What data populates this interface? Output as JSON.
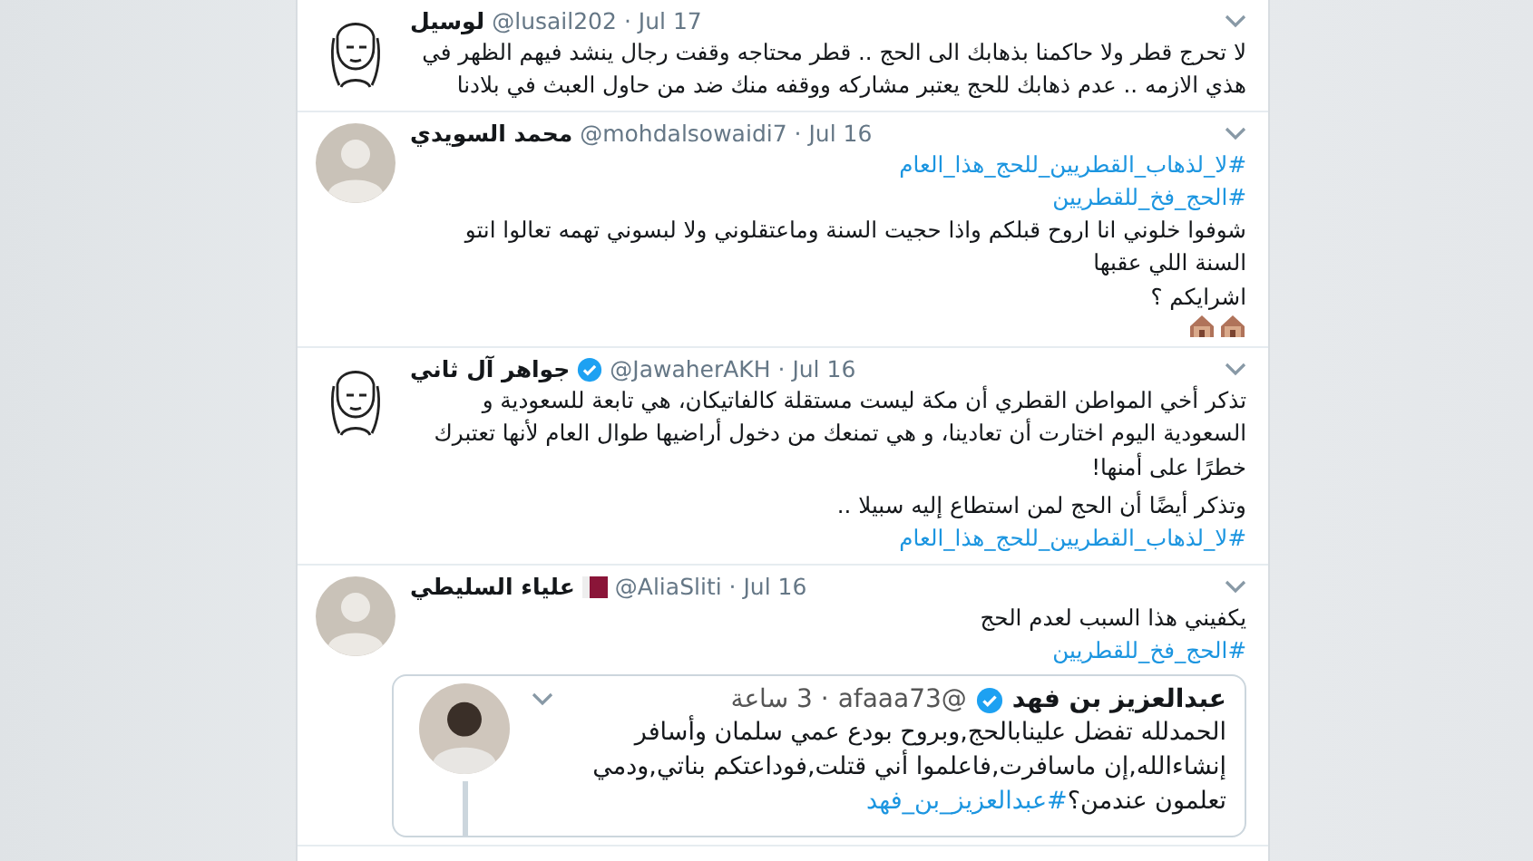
{
  "tweets": [
    {
      "name": "لوسيل",
      "meta": "@lusail202 · Jul 17",
      "avatar": {
        "kind": "sketch"
      },
      "blocks": [
        {
          "kind": "text",
          "text": "لا تحرج قطر ولا حاكمنا بذهابك الى الحج .. قطر محتاجه وقفت رجال ينشد فيهم الظهر في هذي الازمه .. عدم ذهابك للحج يعتبر مشاركه ووقفه منك ضد من حاول العبث في بلادنا"
        }
      ]
    },
    {
      "name": "محمد السويدي",
      "meta": "@mohdalsowaidi7 · Jul 16",
      "avatar": {
        "kind": "photo"
      },
      "blocks": [
        {
          "kind": "hashtag",
          "text": "#لا_لذهاب_القطريين_للحج_هذا_العام"
        },
        {
          "kind": "hashtag",
          "text": "#الحج_فخ_للقطريين"
        },
        {
          "kind": "text",
          "text": "شوفوا خلوني انا اروح قبلكم واذا حجيت السنة وماعتقلوني ولا لبسوني تهمه تعالوا انتو السنة اللي عقبها"
        },
        {
          "kind": "text",
          "text": "اشرايكم ؟"
        },
        {
          "kind": "icons",
          "icons": [
            {
              "kind": "house"
            },
            {
              "kind": "house"
            }
          ]
        }
      ]
    },
    {
      "name": "جواهر آل ثاني",
      "meta": "@JawaherAKH · Jul 16",
      "verified": true,
      "avatar": {
        "kind": "sketch"
      },
      "blocks": [
        {
          "kind": "text",
          "text": "تذكر أخي المواطن القطري أن مكة ليست مستقلة كالفاتيكان، هي تابعة للسعودية و السعودية اليوم اختارت أن تعادينا، و هي تمنعك من دخول أراضيها طوال العام لأنها تعتبرك خطرًا على أمنها!"
        },
        {
          "kind": "gap"
        },
        {
          "kind": "text",
          "text": "وتذكر أيضًا أن الحج لمن استطاع إليه سبيلا .."
        },
        {
          "kind": "hashtag",
          "text": "#لا_لذهاب_القطريين_للحج_هذا_العام"
        }
      ]
    },
    {
      "name": "علياء السليطي",
      "meta": "@AliaSliti · Jul 16",
      "flag": true,
      "avatar": {
        "kind": "photo"
      },
      "blocks": [
        {
          "kind": "text",
          "text": "يكفيني هذا السبب لعدم الحج"
        },
        {
          "kind": "hashtag",
          "text": "#الحج_فخ_للقطريين"
        }
      ],
      "embed": {
        "name": "عبدالعزيز بن فهد",
        "handle": "@afaaa73",
        "time": "· 3 ساعة",
        "verified": true,
        "text": "الحمدلله تفضل علينابالحج,وبروح بودع عمي سلمان وأسافر إنشاءالله,إن ماسافرت,فاعلموا أني قتلت,فوداعتكم بناتي,ودمي تعلمون عندمن؟",
        "hashtag": "#عبدالعزيز_بن_فهد"
      }
    }
  ]
}
